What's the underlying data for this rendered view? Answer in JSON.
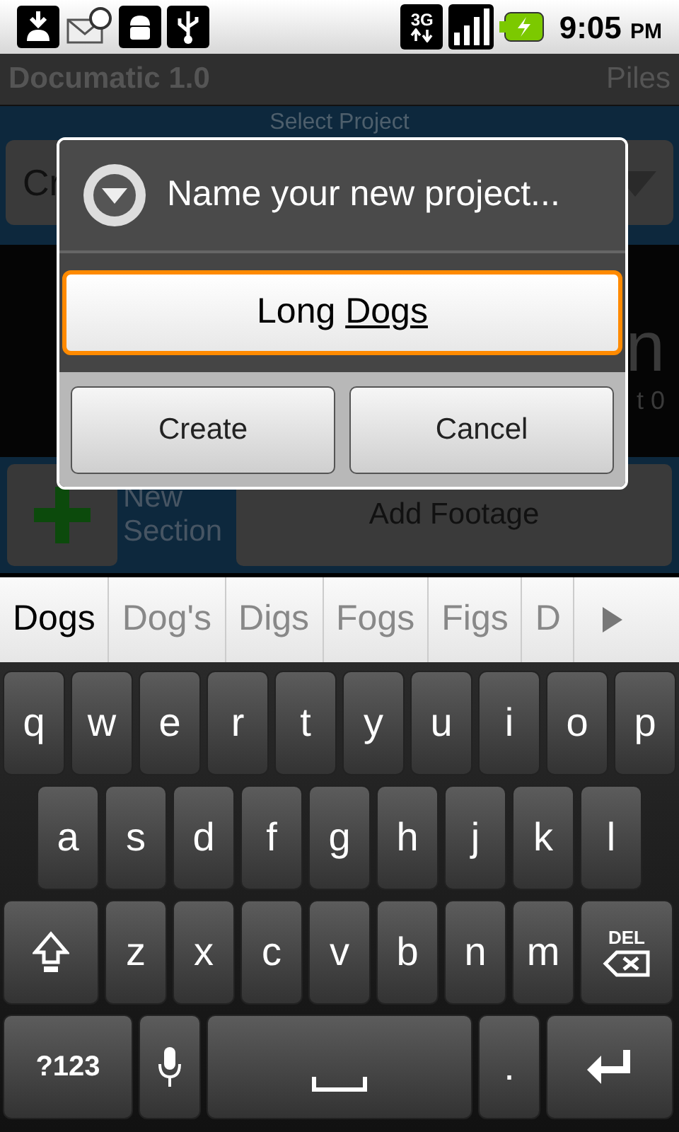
{
  "status_bar": {
    "network": "3G",
    "time": "9:05",
    "ampm": "PM"
  },
  "app_bar": {
    "title": "Documatic 1.0",
    "menu_label": "Piles"
  },
  "project": {
    "label": "Select Project",
    "spinner_value": "Cr"
  },
  "section_row": {
    "title_fragment": "n",
    "count_fragment": "t 0"
  },
  "actions": {
    "new_section_label": "New Section",
    "add_footage_label": "Add Footage"
  },
  "dialog": {
    "title": "Name your new project...",
    "value_plain": "Long ",
    "value_composing": "Dogs",
    "focused": true,
    "buttons": [
      "Create",
      "Cancel"
    ]
  },
  "suggestions": [
    {
      "text": "Dogs",
      "selected": true
    },
    {
      "text": "Dog's",
      "selected": false
    },
    {
      "text": "Digs",
      "selected": false
    },
    {
      "text": "Fogs",
      "selected": false
    },
    {
      "text": "Figs",
      "selected": false
    },
    {
      "text": "D",
      "selected": false
    }
  ],
  "keyboard": {
    "rows": [
      [
        {
          "kind": "letter",
          "label": "q"
        },
        {
          "kind": "letter",
          "label": "w"
        },
        {
          "kind": "letter",
          "label": "e"
        },
        {
          "kind": "letter",
          "label": "r"
        },
        {
          "kind": "letter",
          "label": "t"
        },
        {
          "kind": "letter",
          "label": "y"
        },
        {
          "kind": "letter",
          "label": "u"
        },
        {
          "kind": "letter",
          "label": "i"
        },
        {
          "kind": "letter",
          "label": "o"
        },
        {
          "kind": "letter",
          "label": "p"
        }
      ],
      [
        {
          "kind": "letter",
          "label": "a"
        },
        {
          "kind": "letter",
          "label": "s"
        },
        {
          "kind": "letter",
          "label": "d"
        },
        {
          "kind": "letter",
          "label": "f"
        },
        {
          "kind": "letter",
          "label": "g"
        },
        {
          "kind": "letter",
          "label": "h"
        },
        {
          "kind": "letter",
          "label": "j"
        },
        {
          "kind": "letter",
          "label": "k"
        },
        {
          "kind": "letter",
          "label": "l"
        }
      ],
      [
        {
          "kind": "shift"
        },
        {
          "kind": "letter",
          "label": "z"
        },
        {
          "kind": "letter",
          "label": "x"
        },
        {
          "kind": "letter",
          "label": "c"
        },
        {
          "kind": "letter",
          "label": "v"
        },
        {
          "kind": "letter",
          "label": "b"
        },
        {
          "kind": "letter",
          "label": "n"
        },
        {
          "kind": "letter",
          "label": "m"
        },
        {
          "kind": "delete",
          "label": "DEL"
        }
      ],
      [
        {
          "kind": "symbols",
          "label": "?123"
        },
        {
          "kind": "mic"
        },
        {
          "kind": "space"
        },
        {
          "kind": "letter",
          "label": "."
        },
        {
          "kind": "enter"
        }
      ]
    ]
  }
}
